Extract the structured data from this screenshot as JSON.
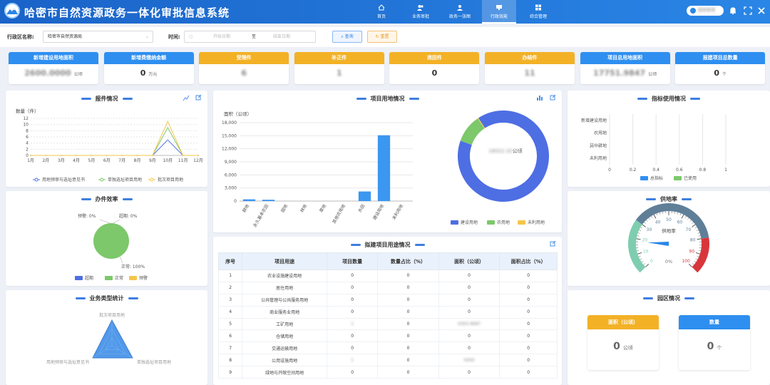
{
  "app": {
    "title": "哈密市自然资源政务一体化审批信息系统",
    "user_name": "超级管理"
  },
  "nav": [
    {
      "label": "首页"
    },
    {
      "label": "业务审批"
    },
    {
      "label": "政务一张图"
    },
    {
      "label": "行政效能"
    },
    {
      "label": "综合管理"
    }
  ],
  "filter": {
    "district_label": "行政区名称:",
    "district_value": "哈密市自然资源局",
    "time_label": "时间:",
    "start_ph": "开始日期",
    "to": "至",
    "end_ph": "结束日期",
    "query": "查询",
    "reset": "重置"
  },
  "kpis": [
    {
      "label": "新增建设用地面积",
      "value": "2600.0000",
      "unit": "公顷",
      "color": "#2e8ff0"
    },
    {
      "label": "新增费缴纳金额",
      "value": "0",
      "unit": "万元",
      "color": "#2e8ff0"
    },
    {
      "label": "受理件",
      "value": "6",
      "unit": "",
      "color": "#f3b126"
    },
    {
      "label": "补正件",
      "value": "1",
      "unit": "",
      "color": "#f3b126"
    },
    {
      "label": "退回件",
      "value": "0",
      "unit": "",
      "color": "#f3b126"
    },
    {
      "label": "办结件",
      "value": "11",
      "unit": "",
      "color": "#f3b126"
    },
    {
      "label": "项目总用地面积",
      "value": "17751.9847",
      "unit": "公顷",
      "color": "#2e8ff0"
    },
    {
      "label": "报建项目总数量",
      "value": "0",
      "unit": "个",
      "color": "#2e8ff0"
    }
  ],
  "panels": {
    "report": "报件情况",
    "efficiency": "办件效率",
    "biz_type": "业务类型统计",
    "land_use": "项目用地情况",
    "planned": "拟建项目用途情况",
    "indicator": "指标使用情况",
    "supply": "供地率",
    "park": "园区情况"
  },
  "report_chart": {
    "ylabel": "数量（件）",
    "months": [
      "1月",
      "2月",
      "3月",
      "4月",
      "5月",
      "6月",
      "7月",
      "8月",
      "9月",
      "10月",
      "11月",
      "12月"
    ],
    "yticks": [
      "0",
      "2",
      "4",
      "6",
      "8",
      "10",
      "12"
    ],
    "chart_data": {
      "type": "line",
      "x": [
        "1月",
        "2月",
        "3月",
        "4月",
        "5月",
        "6月",
        "7月",
        "8月",
        "9月",
        "10月",
        "11月",
        "12月"
      ],
      "ylim": [
        0,
        12
      ],
      "series": [
        {
          "name": "用地预审与选址意见书",
          "color": "#4e6ee3",
          "values": [
            0,
            0,
            0,
            0,
            0,
            0,
            0,
            0,
            0,
            5,
            0,
            0
          ]
        },
        {
          "name": "单独选址项目用地",
          "color": "#7cc86a",
          "values": [
            0,
            0,
            0,
            0,
            0,
            0,
            0,
            0,
            0,
            9,
            0,
            0
          ]
        },
        {
          "name": "批次项目用地",
          "color": "#f5c54a",
          "values": [
            0,
            0,
            0,
            0,
            0,
            0,
            0,
            0,
            0,
            11,
            0,
            0
          ]
        }
      ]
    }
  },
  "efficiency_chart": {
    "chart_data": {
      "type": "pie",
      "labels": [
        "超期",
        "正常",
        "预警"
      ],
      "values": [
        0,
        100,
        0
      ],
      "colors": [
        "#4e6ee3",
        "#7cc86a",
        "#f5c54a"
      ]
    },
    "label_warn": "预警: 0%",
    "label_over": "超期: 0%",
    "label_normal": "正常: 100%"
  },
  "biz_chart": {
    "chart_data": {
      "type": "radar",
      "labels": [
        "批次项目用地",
        "单独选址项目用地",
        "用地预审与选址意见书"
      ]
    }
  },
  "land_chart": {
    "ylabel": "面积（公顷）",
    "yticks": [
      "0",
      "3,000",
      "6,000",
      "9,000",
      "12,000",
      "15,000",
      "18,000"
    ],
    "chart_data": {
      "type": "bar",
      "categories": [
        "耕地",
        "永久基本农田",
        "园地",
        "林地",
        "草地",
        "其他农用地",
        "水田",
        "建设用地",
        "未利用地"
      ],
      "values": [
        400,
        300,
        0,
        0,
        0,
        0,
        2200,
        15100,
        0
      ],
      "ylim": [
        0,
        18000
      ]
    }
  },
  "land_donut": {
    "center_value": "18022.32",
    "center_unit": "公顷",
    "chart_data": {
      "type": "pie",
      "labels": [
        "建设用地",
        "农用地",
        "未利用地"
      ],
      "values": [
        90,
        10,
        0.3
      ],
      "colors": [
        "#4e6ee3",
        "#7cc86a",
        "#f5c54a"
      ]
    }
  },
  "planned_table": {
    "headers": [
      "序号",
      "项目用途",
      "项目数量",
      "数量占比（%）",
      "面积（公顷）",
      "面积占比（%）"
    ],
    "rows": [
      [
        "1",
        "农业设施建设用地",
        "0",
        "0",
        "0",
        "0"
      ],
      [
        "2",
        "居住用地",
        "0",
        "0",
        "0",
        "0"
      ],
      [
        "3",
        "公共管理与公共服务用地",
        "0",
        "0",
        "0",
        "0"
      ],
      [
        "4",
        "商业服务业用地",
        "0",
        "0",
        "0",
        "0"
      ],
      [
        "5",
        "工矿用地",
        "1",
        "0",
        "4393.9687",
        "0"
      ],
      [
        "6",
        "仓储用地",
        "0",
        "0",
        "0",
        "0"
      ],
      [
        "7",
        "交通运输用地",
        "0",
        "0",
        "0",
        "0"
      ],
      [
        "8",
        "公用设施用地",
        "1",
        "0",
        "5000",
        "0"
      ],
      [
        "9",
        "绿地与开敞空间用地",
        "0",
        "0",
        "0",
        "0"
      ]
    ]
  },
  "indicator_chart": {
    "chart_data": {
      "type": "bar",
      "orientation": "horizontal",
      "categories": [
        "新增建设用地",
        "农用地",
        "其中耕地",
        "未利用地"
      ],
      "series": [
        {
          "name": "总指标",
          "color": "#2e8ff0",
          "values": [
            0,
            0,
            0,
            0
          ]
        },
        {
          "name": "已使用",
          "color": "#7cc86a",
          "values": [
            0,
            0,
            0,
            0
          ]
        }
      ],
      "xlim": [
        0,
        1
      ]
    },
    "xticks": [
      "0",
      "0.2",
      "0.4",
      "0.6",
      "0.8",
      "1"
    ]
  },
  "supply_chart": {
    "label": "供地率",
    "value": "0%",
    "ticks": [
      "0",
      "10",
      "20",
      "30",
      "40",
      "50",
      "60",
      "70",
      "80",
      "90",
      "100"
    ],
    "chart_data": {
      "type": "gauge",
      "value": 0,
      "range": [
        0,
        100
      ]
    }
  },
  "park": {
    "area_label": "面积（公顷）",
    "area_value": "0",
    "area_unit": "公顷",
    "count_label": "数量",
    "count_value": "0",
    "count_unit": "个"
  }
}
